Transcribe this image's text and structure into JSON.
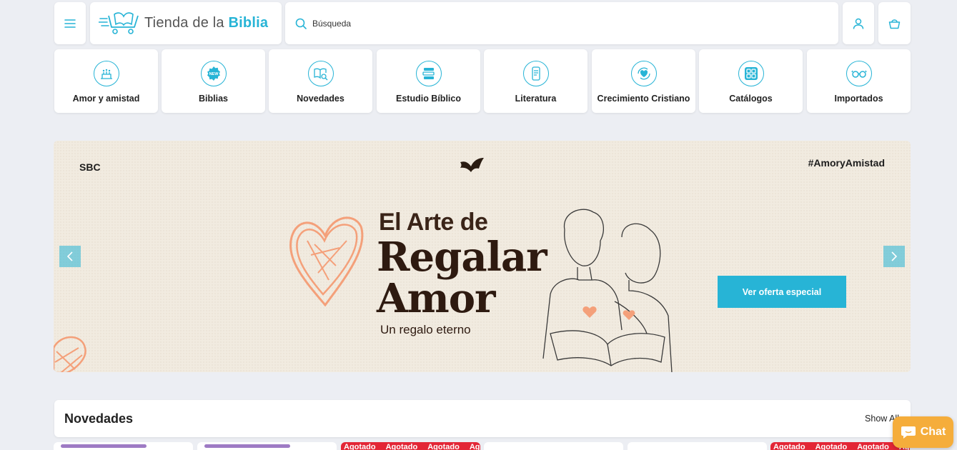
{
  "header": {
    "logo_prefix": "Tienda de la",
    "logo_brand": "Biblia",
    "search_placeholder": "Búsqueda",
    "accent_color": "#27b4d6"
  },
  "categories": [
    {
      "label": "Amor y amistad",
      "icon": "celebration-icon"
    },
    {
      "label": "Biblias",
      "icon": "new-badge-icon"
    },
    {
      "label": "Novedades",
      "icon": "book-search-icon"
    },
    {
      "label": "Estudio Bíblico",
      "icon": "books-stack-icon"
    },
    {
      "label": "Literatura",
      "icon": "phone-reader-icon"
    },
    {
      "label": "Crecimiento Cristiano",
      "icon": "heart-cycle-icon"
    },
    {
      "label": "Catálogos",
      "icon": "grid-icon"
    },
    {
      "label": "Importados",
      "icon": "glasses-icon"
    }
  ],
  "banner": {
    "brand": "SBC",
    "hashtag": "#AmoryAmistad",
    "line1": "El Arte de",
    "line2": "Regalar",
    "line3": "Amor",
    "subtitle": "Un regalo eterno",
    "cta": "Ver oferta especial"
  },
  "section": {
    "title": "Novedades",
    "show_all": "Show All"
  },
  "products": {
    "sold_out_label": "Agotado"
  },
  "chat": {
    "label": "Chat"
  }
}
